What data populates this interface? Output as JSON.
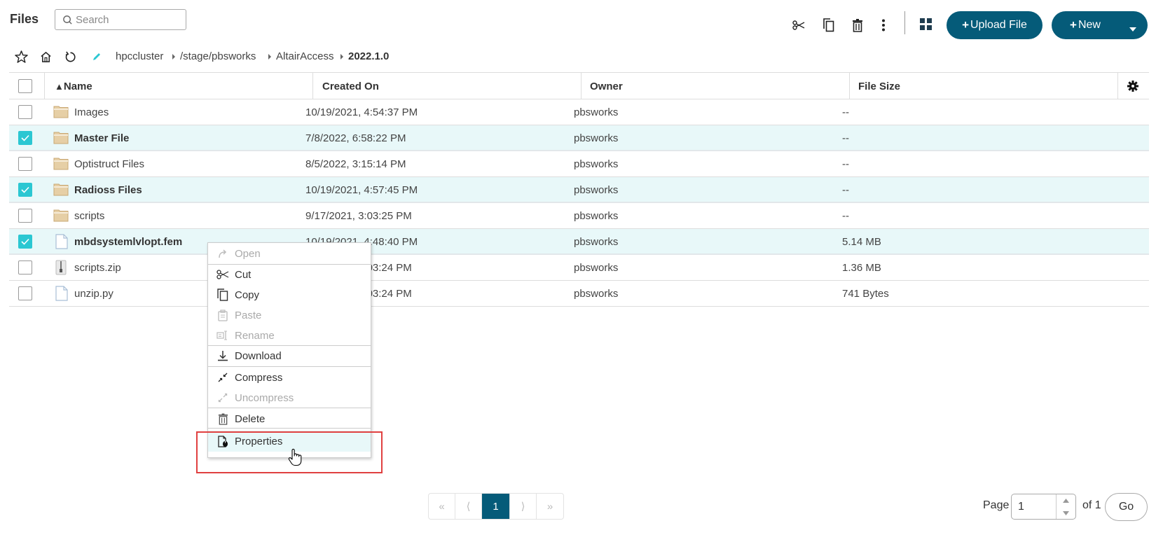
{
  "header": {
    "title": "Files",
    "search_placeholder": "Search",
    "upload_label": "Upload File",
    "new_label": "New",
    "toolbar_icons": [
      "cut-icon",
      "copy-icon",
      "delete-icon",
      "more-vertical-icon",
      "grid-view-icon"
    ]
  },
  "breadcrumb": {
    "items": [
      "hpccluster",
      "/stage/pbsworks",
      "AltairAccess",
      "2022.1.0"
    ]
  },
  "table": {
    "columns": {
      "sort_indicator": "▲",
      "name": "Name",
      "created_on": "Created On",
      "owner": "Owner",
      "file_size": "File Size"
    },
    "rows": [
      {
        "name": "Images",
        "type": "folder",
        "created_on": "10/19/2021, 4:54:37 PM",
        "owner": "pbsworks",
        "size": "--",
        "selected": false
      },
      {
        "name": "Master File",
        "type": "folder",
        "created_on": "7/8/2022, 6:58:22 PM",
        "owner": "pbsworks",
        "size": "--",
        "selected": true
      },
      {
        "name": "Optistruct Files",
        "type": "folder",
        "created_on": "8/5/2022, 3:15:14 PM",
        "owner": "pbsworks",
        "size": "--",
        "selected": false
      },
      {
        "name": "Radioss Files",
        "type": "folder",
        "created_on": "10/19/2021, 4:57:45 PM",
        "owner": "pbsworks",
        "size": "--",
        "selected": true
      },
      {
        "name": "scripts",
        "type": "folder",
        "created_on": "9/17/2021, 3:03:25 PM",
        "owner": "pbsworks",
        "size": "--",
        "selected": false
      },
      {
        "name": "mbdsystemlvlopt.fem",
        "type": "file",
        "created_on": "10/19/2021, 4:48:40 PM",
        "owner": "pbsworks",
        "size": "5.14 MB",
        "selected": true
      },
      {
        "name": "scripts.zip",
        "type": "zip",
        "created_on": "9/17/2021, 3:03:24 PM",
        "owner": "pbsworks",
        "size": "1.36 MB",
        "selected": false
      },
      {
        "name": "unzip.py",
        "type": "file",
        "created_on": "9/17/2021, 3:03:24 PM",
        "owner": "pbsworks",
        "size": "741 Bytes",
        "selected": false
      }
    ]
  },
  "context_menu": {
    "items": [
      {
        "label": "Open",
        "icon": "open-icon",
        "disabled": true
      },
      {
        "label": "Cut",
        "icon": "cut-icon",
        "disabled": false
      },
      {
        "label": "Copy",
        "icon": "copy-icon",
        "disabled": false
      },
      {
        "label": "Paste",
        "icon": "paste-icon",
        "disabled": true
      },
      {
        "label": "Rename",
        "icon": "rename-icon",
        "disabled": true
      },
      {
        "label": "Download",
        "icon": "download-icon",
        "disabled": false
      },
      {
        "label": "Compress",
        "icon": "compress-icon",
        "disabled": false
      },
      {
        "label": "Uncompress",
        "icon": "uncompress-icon",
        "disabled": true
      },
      {
        "label": "Delete",
        "icon": "delete-icon",
        "disabled": false
      },
      {
        "label": "Properties",
        "icon": "properties-icon",
        "disabled": false,
        "hovered": true
      }
    ]
  },
  "pagination": {
    "first": "«",
    "prev": "⟨",
    "current": "1",
    "next": "⟩",
    "last": "»",
    "page_label": "Page",
    "page_value": "1",
    "of_label": "of 1",
    "go_label": "Go"
  },
  "colors": {
    "primary": "#055b79",
    "selected_row": "#e8f8f9",
    "checkbox_checked": "#2bc7d2",
    "highlight": "#e04040"
  }
}
